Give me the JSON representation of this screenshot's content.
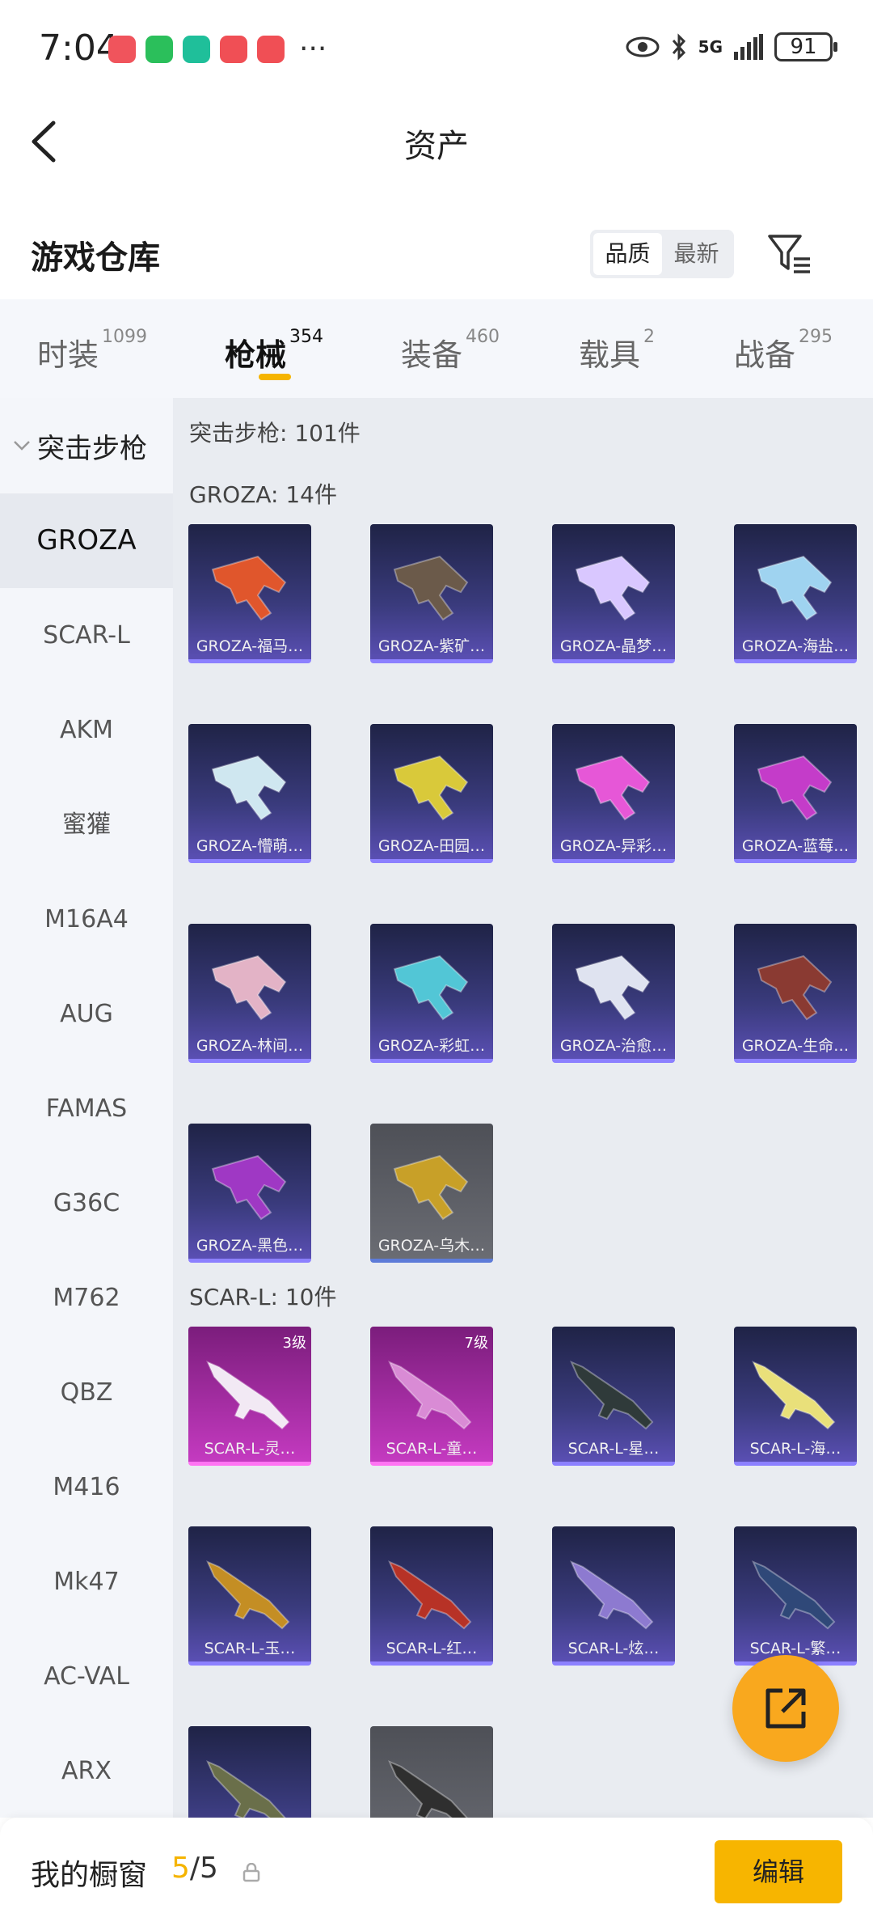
{
  "status_bar": {
    "time": "7:04",
    "network": "5G",
    "battery": "91",
    "app_icons": [
      "#f0545c",
      "#2bbf5b",
      "#1fbf9a",
      "#f04f55",
      "#f04f55"
    ]
  },
  "header": {
    "title": "资产"
  },
  "warehouse": {
    "title": "游戏仓库",
    "sort_options": [
      "品质",
      "最新"
    ],
    "active_sort": "品质"
  },
  "tabs": [
    {
      "label": "时装",
      "count": "1099"
    },
    {
      "label": "枪械",
      "count": "354"
    },
    {
      "label": "装备",
      "count": "460"
    },
    {
      "label": "载具",
      "count": "2"
    },
    {
      "label": "战备",
      "count": "295"
    }
  ],
  "sidebar": {
    "category": "突击步枪",
    "items": [
      "GROZA",
      "SCAR-L",
      "AKM",
      "蜜獾",
      "M16A4",
      "AUG",
      "FAMAS",
      "G36C",
      "M762",
      "QBZ",
      "M416",
      "Mk47",
      "AC-VAL",
      "ARX"
    ]
  },
  "main": {
    "summary": "突击步枪: 101件",
    "sections": [
      {
        "label": "GROZA: 14件",
        "items": [
          {
            "name": "GROZA-福马…",
            "style": "purple",
            "gun": "#e0562c"
          },
          {
            "name": "GROZA-紫矿…",
            "style": "purple",
            "gun": "#6b5a4a"
          },
          {
            "name": "GROZA-晶梦…",
            "style": "purple",
            "gun": "#d9c7ff"
          },
          {
            "name": "GROZA-海盐…",
            "style": "purple",
            "gun": "#9fd3f0"
          },
          {
            "name": "GROZA-懵萌…",
            "style": "purple",
            "gun": "#cfe7f0"
          },
          {
            "name": "GROZA-田园…",
            "style": "purple",
            "gun": "#d9c93a"
          },
          {
            "name": "GROZA-异彩…",
            "style": "purple",
            "gun": "#e657d7"
          },
          {
            "name": "GROZA-蓝莓…",
            "style": "purple",
            "gun": "#c43cc9"
          },
          {
            "name": "GROZA-林间…",
            "style": "purple",
            "gun": "#e3b3c6"
          },
          {
            "name": "GROZA-彩虹…",
            "style": "purple",
            "gun": "#52c6d6"
          },
          {
            "name": "GROZA-治愈…",
            "style": "purple",
            "gun": "#dfe3f0"
          },
          {
            "name": "GROZA-生命…",
            "style": "purple",
            "gun": "#8a3a32"
          },
          {
            "name": "GROZA-黑色…",
            "style": "purple",
            "gun": "#9f38c4"
          },
          {
            "name": "GROZA-乌木…",
            "style": "grey",
            "gun": "#c8a028"
          }
        ]
      },
      {
        "label": "SCAR-L: 10件",
        "items": [
          {
            "name": "SCAR-L-灵…",
            "style": "pink",
            "level": "3级",
            "gun": "#f2e9f4"
          },
          {
            "name": "SCAR-L-童…",
            "style": "pink",
            "level": "7级",
            "gun": "#d98bd5"
          },
          {
            "name": "SCAR-L-星…",
            "style": "purple",
            "gun": "#2f3a3a"
          },
          {
            "name": "SCAR-L-海…",
            "style": "purple",
            "gun": "#e9e07a"
          },
          {
            "name": "SCAR-L-玉…",
            "style": "purple",
            "gun": "#c48e24"
          },
          {
            "name": "SCAR-L-红…",
            "style": "purple",
            "gun": "#b73226"
          },
          {
            "name": "SCAR-L-炫…",
            "style": "purple",
            "gun": "#8d7ad0"
          },
          {
            "name": "SCAR-L-繁…",
            "style": "purple",
            "gun": "#2f4878"
          },
          {
            "name": "",
            "style": "purple",
            "gun": "#6a6f4a"
          },
          {
            "name": "",
            "style": "grey",
            "gun": "#2f2f2f"
          }
        ]
      }
    ]
  },
  "bottom_bar": {
    "label": "我的橱窗",
    "count_current": "5",
    "count_total": "/5",
    "edit_label": "编辑"
  },
  "colors": {
    "accent": "#f5b400",
    "fab": "#f9a81e"
  }
}
